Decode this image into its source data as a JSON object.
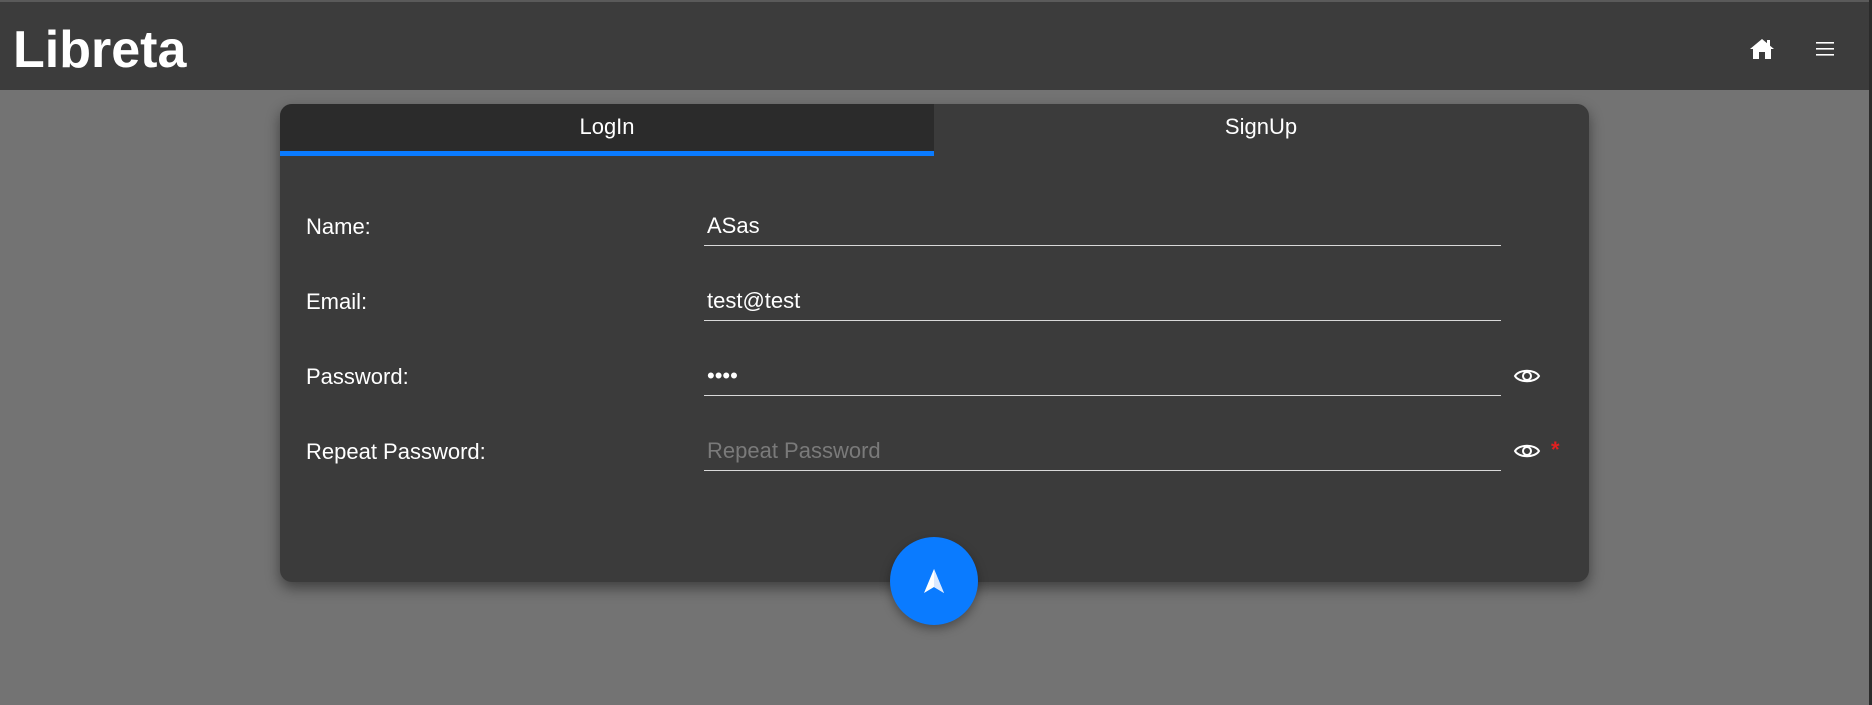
{
  "app": {
    "title": "Libreta"
  },
  "header": {
    "home_icon": "home-icon",
    "menu_icon": "hamburger-menu-icon"
  },
  "tabs": [
    {
      "label": "LogIn",
      "active": true
    },
    {
      "label": "SignUp",
      "active": false
    }
  ],
  "form": {
    "name": {
      "label": "Name:",
      "value": "ASas",
      "placeholder": ""
    },
    "email": {
      "label": "Email:",
      "value": "test@test",
      "placeholder": ""
    },
    "password": {
      "label": "Password:",
      "value": "••••",
      "placeholder": ""
    },
    "repeat_password": {
      "label": "Repeat Password:",
      "value": "",
      "placeholder": "Repeat Password",
      "required_mark": "*"
    }
  },
  "submit": {
    "icon": "send-arrow-icon"
  },
  "colors": {
    "accent": "#0a7bff",
    "header_bg": "#3c3c3c",
    "card_bg": "#3b3b3b",
    "page_bg": "#737373",
    "required": "#e02020"
  }
}
